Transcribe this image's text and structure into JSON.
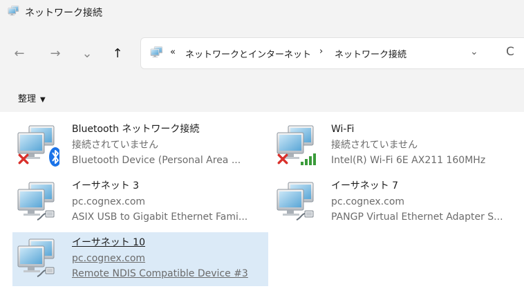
{
  "window": {
    "title": "ネットワーク接続"
  },
  "nav": {
    "back": "←",
    "forward": "→",
    "recent": "⌄",
    "up": "↑"
  },
  "address": {
    "overflow": "«",
    "crumbs": [
      "ネットワークとインターネット",
      "ネットワーク接続"
    ],
    "separator": "›",
    "dropdown": "⌄",
    "refresh": "C"
  },
  "commandbar": {
    "organize": "整理",
    "organize_caret": "▼"
  },
  "connections": [
    {
      "name": "Bluetooth ネットワーク接続",
      "status": "接続されていません",
      "device": "Bluetooth Device (Personal Area ...",
      "icon": "bluetooth-adapter-icon",
      "state": "disconnected"
    },
    {
      "name": "Wi-Fi",
      "status": "接続されていません",
      "device": "Intel(R) Wi-Fi 6E AX211 160MHz",
      "icon": "wifi-adapter-icon",
      "state": "disconnected"
    },
    {
      "name": "イーサネット 3",
      "status": "pc.cognex.com",
      "device": "ASIX USB to Gigabit Ethernet Fami...",
      "icon": "ethernet-adapter-icon",
      "state": "connected"
    },
    {
      "name": "イーサネット 7",
      "status": "pc.cognex.com",
      "device": "PANGP Virtual Ethernet Adapter S...",
      "icon": "ethernet-adapter-icon",
      "state": "connected"
    },
    {
      "name": "イーサネット 10",
      "status": "pc.cognex.com",
      "device": "Remote NDIS Compatible Device #3",
      "icon": "ethernet-adapter-icon",
      "state": "connected",
      "selected": true
    }
  ],
  "colors": {
    "chrome": "#f3f3f3",
    "selection": "#dbeaf7",
    "error": "#d9302b",
    "bluetooth": "#1a73e8",
    "signal": "#3a9b3a"
  }
}
